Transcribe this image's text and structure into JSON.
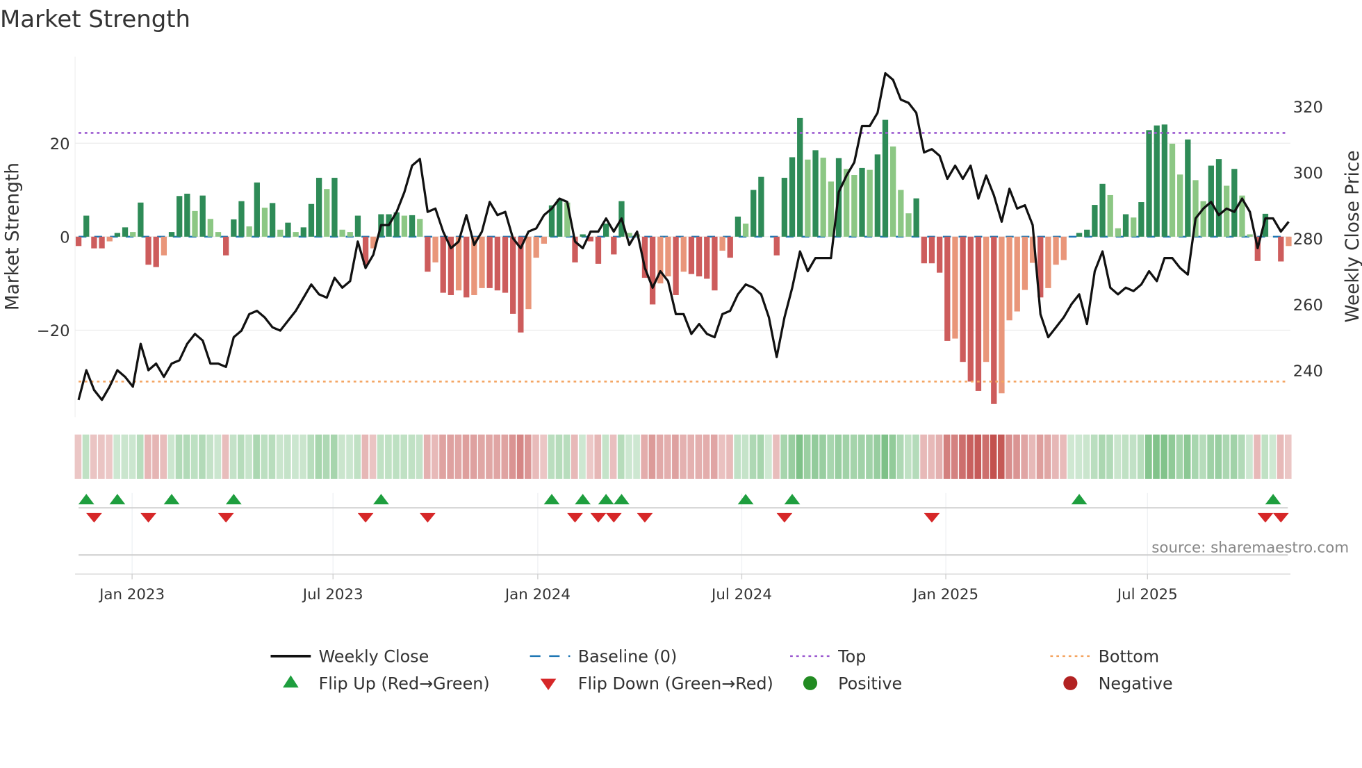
{
  "chart_data": {
    "type": "bar",
    "title": "Market Strength",
    "ylabel": "Market Strength",
    "y2label": "Weekly Close Price",
    "source": "source: sharemaestro.com",
    "ylim": [
      -38.6,
      38.5
    ],
    "y2lim": [
      225.8,
      335
    ],
    "yticks": [
      20,
      0,
      -20
    ],
    "yticklabels": [
      "20",
      "0",
      "−20"
    ],
    "y2ticks": [
      320,
      300,
      280,
      260,
      240
    ],
    "y2ticklabels": [
      "320",
      "300",
      "280",
      "260",
      "240"
    ],
    "top_level": 22.2,
    "bottom_level": -31,
    "xticks": [
      {
        "label": "Jan 2023",
        "week": 6.9
      },
      {
        "label": "Jul 2023",
        "week": 32.8
      },
      {
        "label": "Jan 2024",
        "week": 59.2
      },
      {
        "label": "Jul 2024",
        "week": 85.5
      },
      {
        "label": "Jan 2025",
        "week": 111.8
      },
      {
        "label": "Jul 2025",
        "week": 137.8
      }
    ],
    "strength": [
      -2,
      4.5,
      -2.5,
      -2.5,
      -1,
      0.8,
      2,
      1,
      7.3,
      -6,
      -6.5,
      -4,
      1,
      8.7,
      9.2,
      5.5,
      8.8,
      3.8,
      1,
      -4,
      3.7,
      7.6,
      2.2,
      11.6,
      6.2,
      7.2,
      1.5,
      3,
      1,
      2,
      7,
      12.6,
      10.2,
      12.6,
      1.5,
      1,
      4.5,
      -6,
      -2.5,
      4.8,
      4.8,
      5.2,
      4.5,
      4.6,
      3.8,
      -7.5,
      -5.5,
      -12,
      -12.5,
      -11.5,
      -13,
      -12.5,
      -11,
      -11,
      -11.5,
      -12,
      -16.5,
      -20.5,
      -15.5,
      -4.5,
      -1.5,
      6.7,
      8,
      7.3,
      -5.5,
      0.5,
      -1,
      -5.8,
      2.8,
      -3.8,
      7.6,
      0.8,
      0.5,
      -8.8,
      -14.5,
      -10,
      -8.5,
      -12.5,
      -7.5,
      -8,
      -8.5,
      -9,
      -11.5,
      -3,
      -4.5,
      4.3,
      2.8,
      10,
      12.8,
      0,
      -4,
      12.6,
      17,
      25.4,
      16.5,
      18.5,
      16.9,
      11.8,
      16.8,
      14.5,
      13.2,
      14.7,
      14.3,
      17.6,
      25,
      19.3,
      10,
      5,
      8.2,
      -5.7,
      -5.7,
      -7.7,
      -22.3,
      -21.8,
      -26.8,
      -31,
      -33,
      -26.8,
      -35.8,
      -33.5,
      -17.9,
      -16,
      -11.4,
      -5.6,
      -13,
      -11,
      -6,
      -5,
      0,
      0.8,
      1.5,
      6.8,
      11.3,
      8.9,
      1.8,
      4.8,
      4.1,
      7.4,
      22.8,
      23.8,
      24,
      19.9,
      13.3,
      20.8,
      12.1,
      7.6,
      15.2,
      16.6,
      10.9,
      14.5,
      8.8,
      0.5,
      -5.2,
      4.9,
      0,
      -5.3,
      -2
    ],
    "weekly_close": [
      231,
      240,
      234,
      231,
      235,
      240,
      238,
      235,
      248,
      240,
      242,
      238,
      242,
      243,
      248,
      251,
      249,
      242,
      242,
      241,
      250,
      252,
      257,
      258,
      256,
      253,
      252,
      255,
      258,
      262,
      266,
      263,
      262,
      268,
      265,
      267,
      279,
      271,
      275,
      284,
      284,
      288,
      294,
      302,
      304,
      288,
      289,
      282,
      277,
      279,
      287,
      278,
      282,
      291,
      287,
      288,
      280,
      277,
      282,
      283,
      287,
      289,
      292,
      291,
      279,
      277,
      282,
      282,
      286,
      282,
      286,
      278,
      282,
      271,
      265,
      270,
      267,
      257,
      257,
      251,
      254,
      251,
      250,
      257,
      258,
      263,
      266,
      265,
      263,
      256,
      244,
      256,
      265,
      276,
      270,
      274,
      274,
      274,
      294,
      299,
      303,
      314,
      314,
      318,
      330,
      328,
      322,
      321,
      318,
      306,
      307,
      305,
      298,
      302,
      298,
      302,
      292,
      299,
      293,
      285,
      295,
      289,
      290,
      284,
      257,
      250,
      253,
      256,
      260,
      263,
      254,
      270,
      276,
      265,
      263,
      265,
      264,
      266,
      270,
      267,
      274,
      274,
      271,
      269,
      286,
      289,
      291,
      287,
      289,
      288,
      292,
      288,
      277,
      286,
      286,
      282,
      285
    ],
    "flip_up_weeks": [
      1,
      5,
      12,
      20,
      39,
      61,
      65,
      68,
      70,
      86,
      92,
      129,
      154
    ],
    "flip_down_weeks": [
      2,
      9,
      19,
      37,
      45,
      64,
      67,
      69,
      73,
      91,
      110,
      153,
      155
    ],
    "legend": {
      "position": "bottom",
      "items": [
        {
          "label": "Weekly Close",
          "symbol": "line"
        },
        {
          "label": "Baseline (0)",
          "symbol": "dash"
        },
        {
          "label": "Top",
          "symbol": "dot"
        },
        {
          "label": "Bottom",
          "symbol": "dot"
        },
        {
          "label": "Flip Up (Red→Green)",
          "symbol": "triangle-up"
        },
        {
          "label": "Flip Down (Green→Red)",
          "symbol": "triangle-down"
        },
        {
          "label": "Positive",
          "symbol": "circle"
        },
        {
          "label": "Negative",
          "symbol": "circle"
        }
      ]
    },
    "colors": {
      "pos_strong": "#2e8b57",
      "pos_weak": "#8cc784",
      "neg_strong": "#cd5c5c",
      "neg_weak": "#e9967a",
      "line": "#111111",
      "baseline": "#1f77b4",
      "top": "#9b59d0",
      "bottom": "#f4a460",
      "flip_up": "#1e9e3e",
      "flip_down": "#d62728",
      "positive": "#228b22",
      "negative": "#b22222"
    }
  }
}
